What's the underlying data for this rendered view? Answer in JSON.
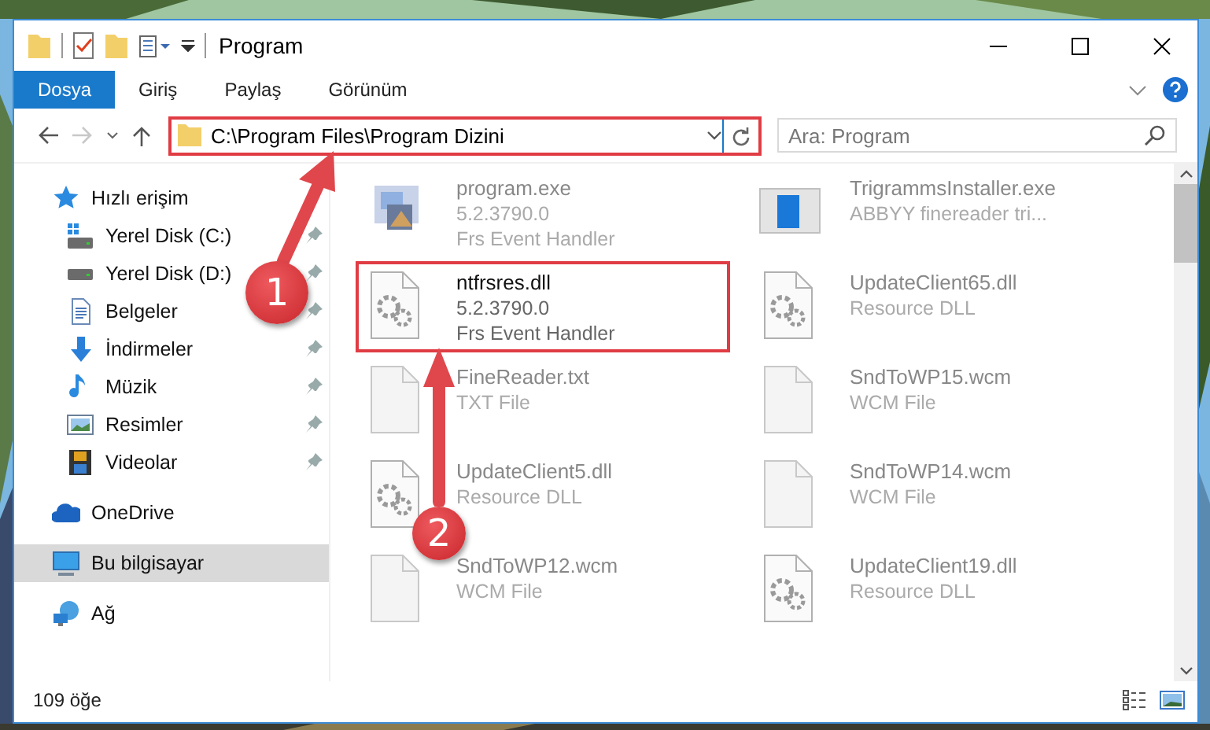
{
  "window": {
    "title": "Program"
  },
  "ribbon_tabs": [
    {
      "label": "Dosya",
      "kind": "file"
    },
    {
      "label": "Giriş",
      "kind": "tab"
    },
    {
      "label": "Paylaş",
      "kind": "tab"
    },
    {
      "label": "Görünüm",
      "kind": "tab"
    }
  ],
  "address": {
    "path": "C:\\Program Files\\Program Dizini",
    "highlighted": true
  },
  "search": {
    "placeholder": "Ara: Program"
  },
  "nav": [
    {
      "label": "Hızlı erişim",
      "selected": false,
      "children": [
        {
          "label": "Yerel Disk (C:)",
          "pinned": true,
          "selected": false
        },
        {
          "label": "Yerel Disk (D:)",
          "pinned": true,
          "selected": false
        },
        {
          "label": "Belgeler",
          "pinned": true,
          "selected": false
        },
        {
          "label": "İndirmeler",
          "pinned": true,
          "selected": false
        },
        {
          "label": "Müzik",
          "pinned": true,
          "selected": false
        },
        {
          "label": "Resimler",
          "pinned": true,
          "selected": false
        },
        {
          "label": "Videolar",
          "pinned": true,
          "selected": false
        }
      ]
    },
    {
      "label": "OneDrive",
      "selected": false
    },
    {
      "label": "Bu bilgisayar",
      "selected": true
    },
    {
      "label": "Ağ",
      "selected": false
    }
  ],
  "files": [
    {
      "name": "program.exe",
      "details": [
        "5.2.3790.0",
        "Frs Event Handler"
      ],
      "kind": "program",
      "highlighted": false
    },
    {
      "name": "TrigrammsInstaller.exe",
      "details": [
        "ABBYY finereader tri..."
      ],
      "kind": "installer",
      "highlighted": false
    },
    {
      "name": "ntfrsres.dll",
      "details": [
        "5.2.3790.0",
        "Frs Event Handler"
      ],
      "kind": "settings",
      "highlighted": true
    },
    {
      "name": "UpdateClient65.dll",
      "details": [
        "Resource DLL"
      ],
      "kind": "settings",
      "highlighted": false
    },
    {
      "name": "FineReader.txt",
      "details": [
        "TXT File"
      ],
      "kind": "blank",
      "highlighted": false
    },
    {
      "name": "SndToWP15.wcm",
      "details": [
        "WCM File"
      ],
      "kind": "blank",
      "highlighted": false
    },
    {
      "name": "UpdateClient5.dll",
      "details": [
        "Resource DLL"
      ],
      "kind": "settings",
      "highlighted": false
    },
    {
      "name": "SndToWP14.wcm",
      "details": [
        "WCM File"
      ],
      "kind": "blank",
      "highlighted": false
    },
    {
      "name": "SndToWP12.wcm",
      "details": [
        "WCM File"
      ],
      "kind": "blank",
      "highlighted": false
    },
    {
      "name": "UpdateClient19.dll",
      "details": [
        "Resource DLL"
      ],
      "kind": "settings",
      "highlighted": false
    }
  ],
  "status_bar": {
    "count": "109 öğe"
  },
  "callouts": [
    {
      "label": "1"
    },
    {
      "label": "2"
    }
  ]
}
